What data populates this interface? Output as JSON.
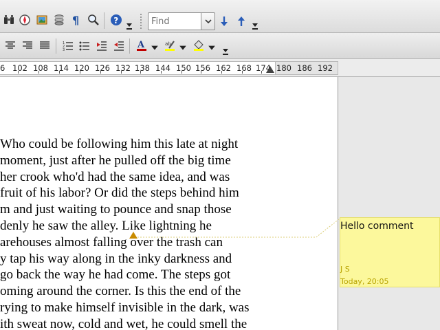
{
  "toolbar1": {
    "icons": [
      "binoculars-icon",
      "navigator-icon",
      "gallery-icon",
      "data-sources-icon",
      "formatting-marks-icon",
      "zoom-icon",
      "help-icon"
    ],
    "find_placeholder": "Find",
    "find_value": ""
  },
  "toolbar2": {
    "icons": [
      "align-center-icon",
      "align-right-icon",
      "justify-icon",
      "numbering-icon",
      "bullets-icon",
      "decrease-indent-icon",
      "increase-indent-icon",
      "font-color-icon",
      "highlighting-icon",
      "background-color-icon"
    ],
    "colors": {
      "font": "#c00000",
      "highlight": "#ffff00",
      "background": "#ffff00"
    }
  },
  "ruler": {
    "labels": [
      "6",
      "102",
      "108",
      "114",
      "120",
      "126",
      "132",
      "138",
      "144",
      "150",
      "156",
      "162",
      "168",
      "174",
      "180",
      "186",
      "192"
    ]
  },
  "document": {
    "lines": [
      "Who could be following him this late at night",
      "moment, just after he pulled off the big time",
      "her crook who'd had the same idea, and was",
      "fruit of his labor? Or did the steps behind him",
      "m and just waiting to pounce and snap those",
      "denly he saw the alley. Like lightning he",
      "arehouses almost falling over the trash can",
      "y tap his way along in the inky darkness and",
      "go back the way he had come. The steps got",
      "oming around the corner. Is this the end of the",
      "rying to make himself invisible in the dark, was",
      "ith sweat now, cold and wet, he could smell the"
    ]
  },
  "comment": {
    "text": "Hello comment",
    "author": "J S",
    "date": "Today, 20:05",
    "color": "#fcf89c"
  }
}
